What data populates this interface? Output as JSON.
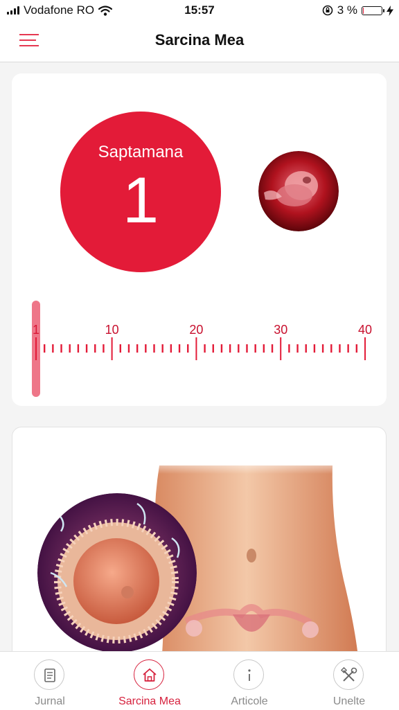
{
  "status": {
    "carrier": "Vodafone RO",
    "time": "15:57",
    "battery": "3 %",
    "battery_level": 0.03
  },
  "header": {
    "title": "Sarcina Mea",
    "menu_icon": "hamburger-icon"
  },
  "week_card": {
    "label": "Saptamana",
    "week": "1",
    "fetus_image": "fetus-image",
    "scale": {
      "min": 1,
      "max": 40,
      "current": 1,
      "labels": [
        "1",
        "10",
        "20",
        "30",
        "40"
      ]
    }
  },
  "illustration": {
    "name": "conception-illustration"
  },
  "tabs": [
    {
      "label": "Jurnal",
      "icon": "journal-icon",
      "active": false
    },
    {
      "label": "Sarcina Mea",
      "icon": "home-icon",
      "active": true
    },
    {
      "label": "Articole",
      "icon": "info-icon",
      "active": false
    },
    {
      "label": "Unelte",
      "icon": "tools-icon",
      "active": false
    }
  ],
  "colors": {
    "accent": "#e31b38",
    "tab_active": "#d6213d",
    "tab_inactive": "#8a8a8a"
  }
}
